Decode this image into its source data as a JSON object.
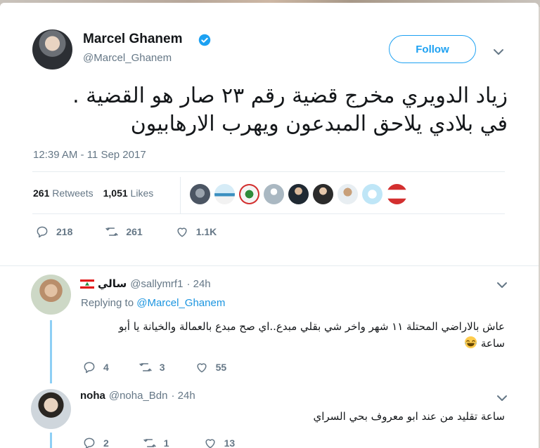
{
  "tweet": {
    "author_name": "Marcel Ghanem",
    "author_handle": "@Marcel_Ghanem",
    "follow_label": "Follow",
    "text_line1": "زياد الدويري مخرج قضية رقم ٢٣ صار هو القضية .",
    "text_line2": "في بلادي يلاحق المبدعون ويهرب الارهابيون",
    "timestamp": "12:39 AM - 11 Sep 2017",
    "retweets_count": "261",
    "retweets_label": "Retweets",
    "likes_count": "1,051",
    "likes_label": "Likes",
    "reply_count": "218",
    "retweet_action_count": "261",
    "like_action_count": "1.1K"
  },
  "replies": [
    {
      "name": "سالي",
      "handle": "@sallymrf1",
      "time": "· 24h",
      "replying_label": "Replying to",
      "replying_to": "@Marcel_Ghanem",
      "text_line1": "عاش بالاراضي المحتلة ١١ شهر  واخر شي بقلي مبدع..اي صح مبدع بالعمالة والخيانة يا أبو",
      "text_line2": "ساعة",
      "reply_count": "4",
      "retweet_count": "3",
      "like_count": "55"
    },
    {
      "name": "noha",
      "handle": "@noha_Bdn",
      "time": "· 24h",
      "text_line1": "ساعة تقليد من عند ابو معروف بحي السراي",
      "reply_count": "2",
      "retweet_count": "1",
      "like_count": "13"
    }
  ],
  "colors": {
    "accent": "#1da1f2",
    "link": "#1b95e0",
    "secondary_text": "#657786",
    "primary_text": "#14171a",
    "thread_line": "#8ecff5"
  }
}
